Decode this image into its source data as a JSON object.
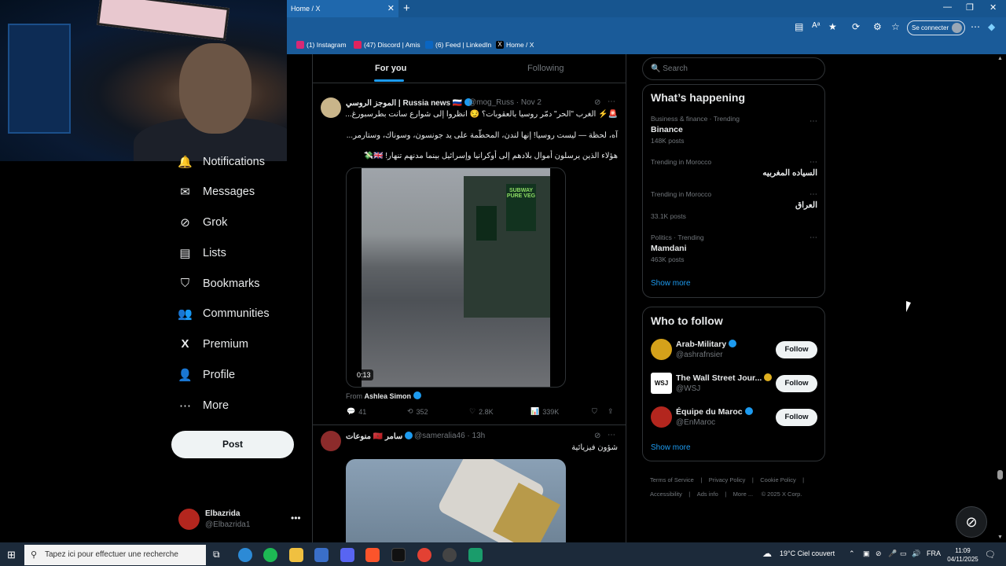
{
  "browser": {
    "tab_title": "Home / X",
    "tab_close": "✕",
    "new_tab": "+",
    "connect_label": "Se connecter",
    "favorites": [
      {
        "label": "(1) Instagram",
        "color": "#d62976"
      },
      {
        "label": "(47) Discord | Amis",
        "color": "#e0245e"
      },
      {
        "label": "(6) Feed | LinkedIn",
        "color": "#0a66c2"
      },
      {
        "label": "Home / X",
        "color": "#000000"
      }
    ]
  },
  "nav": {
    "items": [
      {
        "label": "Notifications",
        "icon": "bell-icon"
      },
      {
        "label": "Messages",
        "icon": "envelope-icon"
      },
      {
        "label": "Grok",
        "icon": "grok-icon"
      },
      {
        "label": "Lists",
        "icon": "list-icon"
      },
      {
        "label": "Bookmarks",
        "icon": "bookmark-icon"
      },
      {
        "label": "Communities",
        "icon": "people-icon"
      },
      {
        "label": "Premium",
        "icon": "x-logo-icon"
      },
      {
        "label": "Profile",
        "icon": "person-icon"
      },
      {
        "label": "More",
        "icon": "more-circle-icon"
      }
    ],
    "post_label": "Post",
    "account": {
      "name": "Elbazrida",
      "handle": "@Elbazrida1"
    }
  },
  "feed": {
    "tabs": {
      "for_you": "For you",
      "following": "Following"
    },
    "tweet1": {
      "name": "الموجز الروسي | Russia news 🇷🇺",
      "handle": "@mog_Russ",
      "date": "Nov 2",
      "line1": "🚨⚡ الغرب \"الحر\" دمّر روسيا بالعقوبات؟ 😏 انظروا إلى شوارع سانت بطرسبورغ...",
      "line2": "آه، لحظة — ليست روسيا! إنها لندن، المحطّمة على يد جونسون، وسوناك، وستارمر...",
      "line3": "هؤلاء الذين يرسلون أموال بلادهم إلى أوكرانيا وإسرائيل بينما مدنهم تنهار! 🇬🇧💸",
      "video_duration": "0:13",
      "from_prefix": "From",
      "from_name": "Ashlea Simon",
      "sign_text": "SUBWAY PURE VEG",
      "stats": {
        "replies": "41",
        "reposts": "352",
        "likes": "2.8K",
        "views": "339K"
      }
    },
    "tweet2": {
      "name": "منوعات 🇲🇦 سامر",
      "handle": "@sameralia46",
      "date": "13h",
      "text": "شؤون فيزيائية"
    }
  },
  "sidebar": {
    "search_placeholder": "Search",
    "whats_happening": {
      "title": "What’s happening",
      "trends": [
        {
          "context": "Business & finance · Trending",
          "name": "Binance",
          "posts": "148K posts"
        },
        {
          "context": "Trending in Morocco",
          "name": "السياده المغربيه",
          "posts": ""
        },
        {
          "context": "Trending in Morocco",
          "name": "العراق",
          "posts": "33.1K posts"
        },
        {
          "context": "Politics · Trending",
          "name": "Mamdani",
          "posts": "463K posts"
        }
      ],
      "show_more": "Show more"
    },
    "who_to_follow": {
      "title": "Who to follow",
      "accounts": [
        {
          "name": "Arab-Military",
          "handle": "@ashrafnsier",
          "avatar_color": "#d4a11a",
          "badge": "blue"
        },
        {
          "name": "The Wall Street Jour...",
          "handle": "@WSJ",
          "avatar_color": "#ffffff",
          "avatar_text": "WSJ",
          "badge": "gold"
        },
        {
          "name": "Équipe du Maroc",
          "handle": "@EnMaroc",
          "avatar_color": "#b3261e",
          "badge": "blue"
        }
      ],
      "follow_label": "Follow",
      "show_more": "Show more"
    },
    "footer": {
      "links": [
        "Terms of Service",
        "Privacy Policy",
        "Cookie Policy",
        "Accessibility",
        "Ads info",
        "More ...",
        "© 2025 X Corp."
      ],
      "separator": "|"
    }
  },
  "taskbar": {
    "search_placeholder": "Tapez ici pour effectuer une recherche",
    "weather": "19°C  Ciel couvert",
    "lang": "FRA",
    "time": "11:09",
    "date": "04/11/2025"
  }
}
